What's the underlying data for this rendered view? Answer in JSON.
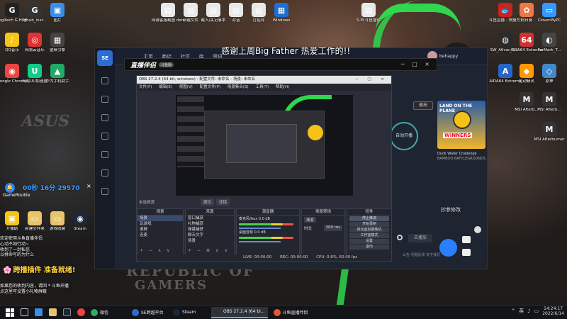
{
  "stream": {
    "title": "感谢上周Big Father 热爱工作的!!",
    "promo_flower": "🌸",
    "promo_text": "跨播插件 准备就绪!",
    "counter": "00秒 16分 29570",
    "counter_close": "×",
    "gaosi": "GameRouble",
    "chat_top": "欢迎使用斗鱼直播伴侣\n心动不如行动~\n收到了一封私信\n以拼命写的为什么",
    "chat_bottom": "如果您的收到内容，请回 * 斗鱼开播\n点这里可设置小礼物屏蔽"
  },
  "desktop_icons_left": [
    {
      "label": "Logitech G HUB",
      "color": "#222",
      "glyph": "G"
    },
    {
      "label": "lghub_inst...",
      "color": "#333",
      "glyph": "G"
    },
    {
      "label": "图片",
      "color": "#3a8ee6",
      "glyph": "▣"
    },
    {
      "label": "QQ音乐",
      "color": "#f5c518",
      "glyph": "♪"
    },
    {
      "label": "网易云音乐",
      "color": "#d33",
      "glyph": "◎"
    },
    {
      "label": "壁纸引擎",
      "color": "#444",
      "glyph": "▦"
    },
    {
      "label": "Google Chrome",
      "color": "#e44",
      "glyph": "◉"
    },
    {
      "label": "网易UU加速器",
      "color": "#1c8",
      "glyph": "U"
    },
    {
      "label": "华为手机助手",
      "color": "#2a6",
      "glyph": "▲"
    }
  ],
  "desktop_icons_top": [
    {
      "label": "网游客服截图 demo",
      "color": "#e8e8e8",
      "glyph": "▤"
    },
    {
      "label": "新建文件",
      "color": "#e8e8e8",
      "glyph": "▤"
    },
    {
      "label": "截入/关记事本",
      "color": "#e8e8e8",
      "glyph": "▤"
    },
    {
      "label": "对话",
      "color": "#e8e8e8",
      "glyph": "▤"
    },
    {
      "label": "打招呼",
      "color": "#e8e8e8",
      "glyph": "▤"
    },
    {
      "label": "Windows",
      "color": "#1f6fd1",
      "glyph": "▦"
    },
    {
      "label": "S.M.斗鱼插件",
      "color": "#e8e8e8",
      "glyph": "▤"
    }
  ],
  "desktop_icons_right": [
    {
      "label": "斗鱼直播 - 快捷方式",
      "color": "#c22",
      "glyph": "🐟"
    },
    {
      "label": "向日葵",
      "color": "#e74",
      "glyph": "✿"
    },
    {
      "label": "CloverMyPC",
      "color": "#39f",
      "glyph": "▭"
    },
    {
      "label": "SW_Afiver_Sp...",
      "color": "#2a2a2a",
      "glyph": "◍"
    },
    {
      "label": "AIDA64 Extreme",
      "color": "#c33",
      "glyph": "64"
    },
    {
      "label": "FurMark_T...",
      "color": "#444",
      "glyph": "◐"
    },
    {
      "label": "AIDA64 Extreme",
      "color": "#2766c8",
      "glyph": "A"
    },
    {
      "label": "驱动精灵",
      "color": "#f90",
      "glyph": "◆"
    },
    {
      "label": "原神",
      "color": "#48c",
      "glyph": "◇"
    },
    {
      "label": "MSI Afterb...",
      "color": "#333",
      "glyph": "M"
    },
    {
      "label": "MSI Afterb...",
      "color": "#333",
      "glyph": "M"
    },
    {
      "label": "MSI Afterburner",
      "color": "#333",
      "glyph": "M"
    }
  ],
  "desktop_icons_mid": [
    {
      "label": "开播助",
      "color": "#f5c518",
      "glyph": "▣"
    },
    {
      "label": "新建文件夹",
      "color": "#e9c46a",
      "glyph": "▭"
    },
    {
      "label": "游戏收藏",
      "color": "#e9c46a",
      "glyph": "▭"
    },
    {
      "label": "Steam",
      "color": "#1b2838",
      "glyph": "◉"
    }
  ],
  "bgapp": {
    "logo": "SE",
    "nav": [
      "主页",
      "商店",
      "社区",
      "库",
      "资讯"
    ],
    "username": "behappy",
    "exit_label": "退出",
    "start_label": "自动开播",
    "game_title": "LAND ON THE PLANE",
    "game_win": "WINNERS",
    "game_sub": "Duck Water Challenge",
    "game_caption": "BAMBOO BATTLEGROUNDS",
    "dropdown_caption": "抄参修改",
    "confirm_label": "去播放",
    "footer_links": "公告   问题反馈   关于我们"
  },
  "assistant": {
    "logo": "直播伴侣",
    "badge": "斗鱼版",
    "controls": "─ □ ×"
  },
  "obs": {
    "title": "OBS 27.2.4 (64 bit, windows) - 配置文件: 未命名 - 场景: 未命名",
    "controls": "─ □ ×",
    "menu": [
      "文件(F)",
      "编辑(E)",
      "视图(V)",
      "配置文件(P)",
      "场景集合(S)",
      "工具(T)",
      "帮助(H)"
    ],
    "no_source": "未选择源",
    "properties": "属性",
    "filters": "滤镜",
    "docks": {
      "scenes": {
        "head": "场景",
        "rows": [
          "场景",
          "玩游戏",
          "谢屏",
          "连麦"
        ]
      },
      "sources": {
        "head": "来源",
        "rows": [
          "窗口捕获",
          "礼物捕获",
          "弹幕捕获",
          "聊天文字",
          "场景"
        ]
      },
      "mixer": {
        "head": "混音器",
        "ch1": "麦克风/Aux",
        "ch1_db": "0.0 dB",
        "ch2": "桌面音频",
        "ch2_db": "0.0 dB"
      },
      "transitions": {
        "head": "场景转场",
        "type": "渐变",
        "duration_label": "时长",
        "duration": "300 ms"
      },
      "controls": {
        "head": "控件",
        "buttons": [
          "停止推流",
          "开始录制",
          "启动虚拟摄像机",
          "工作室模式",
          "设置",
          "退出"
        ]
      }
    },
    "statusbar": [
      "LIVE: 00:00:00",
      "REC: 00:00:00",
      "CPU: 0.8%, 60.00 fps"
    ]
  },
  "taskbar": {
    "apps": [
      {
        "label": "微信",
        "color": "#2aae67"
      },
      {
        "label": "SE跨越平台",
        "color": "#2d6dd2"
      },
      {
        "label": "Steam",
        "color": "#1b2838"
      },
      {
        "label": "OBS 27.2.4 (64 bi...",
        "color": "#302e31"
      },
      {
        "label": "斗鱼直播伴侣",
        "color": "#e5553b"
      }
    ],
    "time": "14:24:17",
    "date": "2022/6/14",
    "tray_symbols": [
      "^",
      "英",
      "♪",
      "▭"
    ]
  }
}
